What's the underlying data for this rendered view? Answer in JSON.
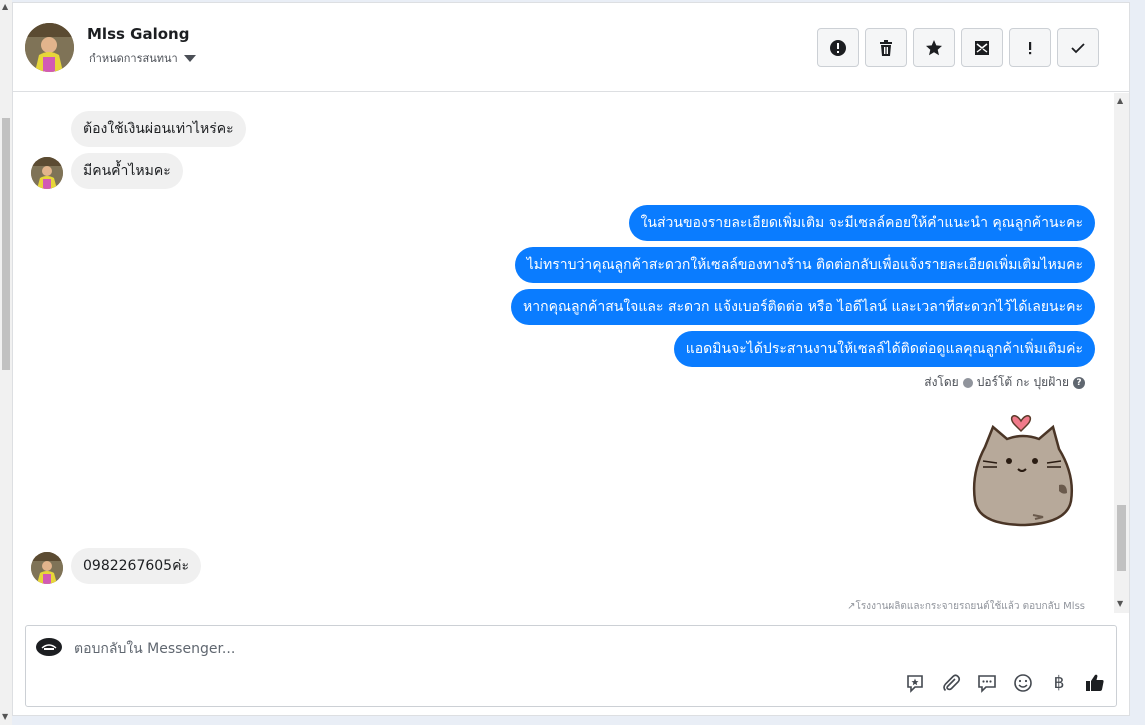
{
  "header": {
    "name": "Mlss Galong",
    "subtitle": "กำหนดการสนทนา"
  },
  "actions": [
    {
      "name": "report-button",
      "icon": "alert-icon"
    },
    {
      "name": "delete-button",
      "icon": "trash-icon"
    },
    {
      "name": "star-button",
      "icon": "star-icon"
    },
    {
      "name": "mark-unread-button",
      "icon": "envelope-icon"
    },
    {
      "name": "important-button",
      "icon": "exclamation-icon"
    },
    {
      "name": "done-button",
      "icon": "check-icon"
    }
  ],
  "messages": {
    "incoming": [
      "ต้องใช้เงินผ่อนเท่าไหร่คะ",
      "มีคนค้ำไหมคะ",
      "0982267605ค่ะ"
    ],
    "outgoing": [
      "ในส่วนของรายละเอียดเพิ่มเติม จะมีเซลล์คอยให้คำแนะนำ คุณลูกค้านะคะ",
      "ไม่ทราบว่าคุณลูกค้าสะดวกให้เซลล์ของทางร้าน ติดต่อกลับเพื่อแจ้งรายละเอียดเพิ่มเติมไหมคะ",
      "หากคุณลูกค้าสนใจและ สะดวก แจ้งเบอร์ติดต่อ หรือ ไอดีไลน์ และเวลาที่สะดวกไว้ได้เลยนะคะ",
      "แอดมินจะได้ประสานงานให้เซลล์ได้ติดต่อดูแลคุณลูกค้าเพิ่มเติมค่ะ"
    ],
    "sent_by_prefix": "ส่งโดย",
    "sent_by_name": "ปอร์โต้ กะ ปุยฝ้าย",
    "reply_note": "↗โรงงานผลิตและกระจายรถยนต์ใช้แล้ว ตอบกลับ Mlss"
  },
  "composer": {
    "placeholder": "ตอบกลับใน Messenger..."
  },
  "tools": [
    {
      "name": "saved-replies-button",
      "icon": "speech-star-icon"
    },
    {
      "name": "attach-button",
      "icon": "paperclip-icon"
    },
    {
      "name": "quick-reply-button",
      "icon": "chat-bubble-icon"
    },
    {
      "name": "emoji-button",
      "icon": "smiley-icon"
    },
    {
      "name": "payment-button",
      "icon": "baht-icon",
      "glyph": "฿"
    },
    {
      "name": "like-button",
      "icon": "thumbs-up-icon"
    }
  ]
}
